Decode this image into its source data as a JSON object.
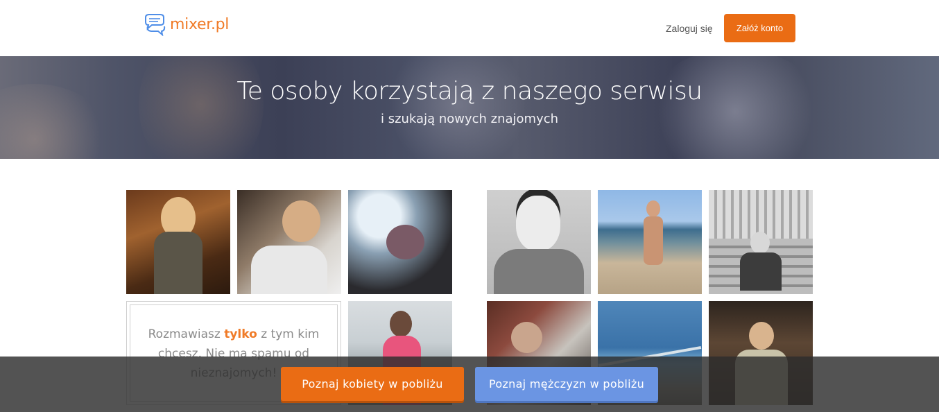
{
  "header": {
    "logo_text": "mixer.pl",
    "login_label": "Zaloguj się",
    "signup_label": "Załóż konto"
  },
  "hero": {
    "title": "Te osoby korzystają z naszego serwisu",
    "subtitle": "i szukają nowych znajomych"
  },
  "info_box": {
    "text_before": "Rozmawiasz ",
    "text_highlight": "tylko",
    "text_after": " z tym kim chcesz. Nie ma spamu od nieznajomych!"
  },
  "cta": {
    "women_label": "Poznaj kobiety w pobliżu",
    "men_label": "Poznaj mężczyzn w pobliżu"
  },
  "colors": {
    "brand_orange": "#ea6c14",
    "men_blue": "#6b95e3",
    "logo_blue": "#4f8ee8"
  }
}
